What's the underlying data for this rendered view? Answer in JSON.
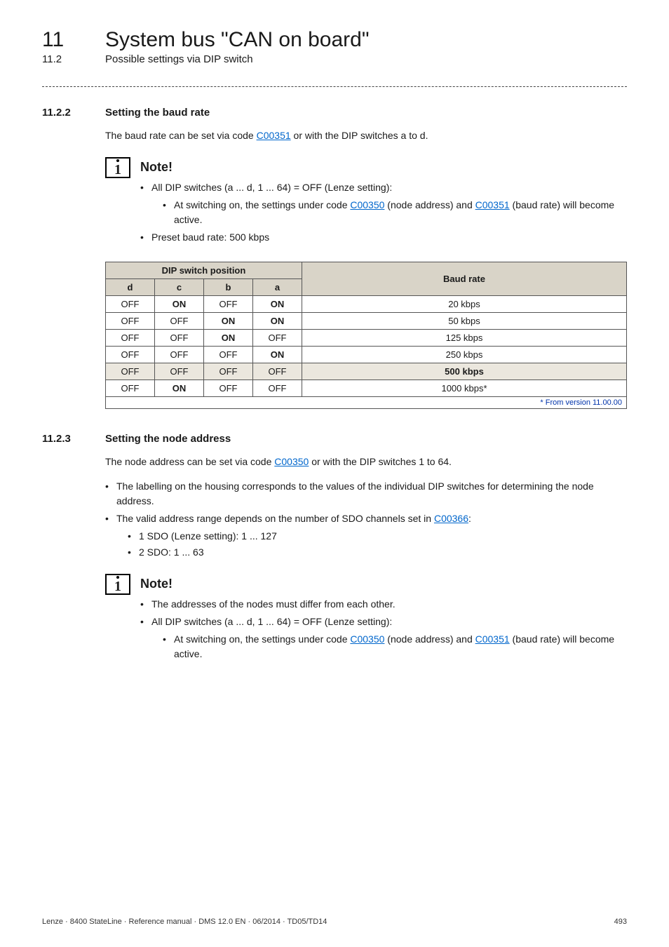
{
  "header": {
    "chapter_num": "11",
    "chapter_title": "System bus \"CAN on board\"",
    "sub_num": "11.2",
    "sub_title": "Possible settings via DIP switch"
  },
  "section1": {
    "num": "11.2.2",
    "title": "Setting the baud rate",
    "intro_pre": "The baud rate can be set via code ",
    "intro_link": "C00351",
    "intro_post": " or with the DIP switches a to d.",
    "note_label": "Note!",
    "note_b1": "All DIP switches (a ... d, 1 ... 64) = OFF (Lenze setting):",
    "note_b1_sub_pre": "At switching on, the settings under code ",
    "note_b1_sub_link1": "C00350",
    "note_b1_sub_mid": " (node address) and ",
    "note_b1_sub_link2": "C00351",
    "note_b1_sub_post": " (baud rate) will become active.",
    "note_b2": "Preset baud rate: 500 kbps"
  },
  "table": {
    "head_group1": "DIP switch position",
    "head_group2": "Baud rate",
    "col_d": "d",
    "col_c": "c",
    "col_b": "b",
    "col_a": "a",
    "rows": [
      {
        "d": "OFF",
        "c": "ON",
        "b": "OFF",
        "a": "ON",
        "rate": "20 kbps",
        "hilite": false
      },
      {
        "d": "OFF",
        "c": "OFF",
        "b": "ON",
        "a": "ON",
        "rate": "50 kbps",
        "hilite": false
      },
      {
        "d": "OFF",
        "c": "OFF",
        "b": "ON",
        "a": "OFF",
        "rate": "125 kbps",
        "hilite": false
      },
      {
        "d": "OFF",
        "c": "OFF",
        "b": "OFF",
        "a": "ON",
        "rate": "250 kbps",
        "hilite": false
      },
      {
        "d": "OFF",
        "c": "OFF",
        "b": "OFF",
        "a": "OFF",
        "rate": "500 kbps",
        "hilite": true
      },
      {
        "d": "OFF",
        "c": "ON",
        "b": "OFF",
        "a": "OFF",
        "rate": "1000 kbps*",
        "hilite": false
      }
    ],
    "footer": "* From version 11.00.00"
  },
  "section2": {
    "num": "11.2.3",
    "title": "Setting the node address",
    "intro_pre": "The node address can be set via code ",
    "intro_link": "C00350",
    "intro_post": " or with the DIP switches 1 to 64.",
    "b1": "The labelling on the housing corresponds to the values of the individual DIP switches for determining the node address.",
    "b2_pre": "The valid address range depends on the number of SDO channels set in ",
    "b2_link": "C00366",
    "b2_post": ":",
    "b2_sub1": "1 SDO (Lenze setting): 1 ... 127",
    "b2_sub2": "2 SDO: 1 ... 63",
    "note_label": "Note!",
    "note_b1": "The addresses of the nodes must differ from each other.",
    "note_b2": "All DIP switches (a ... d, 1 ... 64) = OFF (Lenze setting):",
    "note_b2_sub_pre": "At switching on, the settings under code ",
    "note_b2_sub_link1": "C00350",
    "note_b2_sub_mid": " (node address) and ",
    "note_b2_sub_link2": "C00351",
    "note_b2_sub_post": " (baud rate) will become active."
  },
  "footer": {
    "left": "Lenze · 8400 StateLine · Reference manual · DMS 12.0 EN · 06/2014 · TD05/TD14",
    "right": "493"
  }
}
